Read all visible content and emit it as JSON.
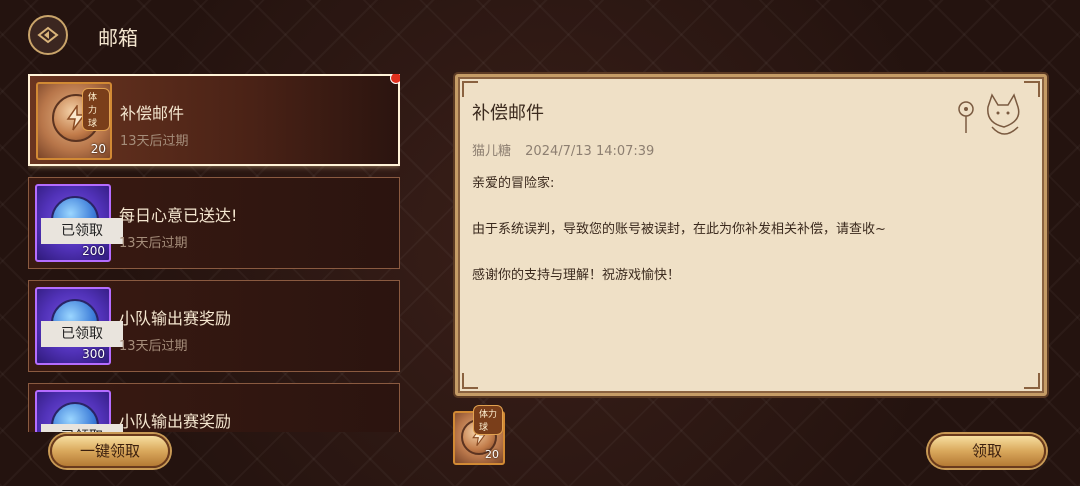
{
  "header": {
    "title": "邮箱"
  },
  "mails": [
    {
      "name": "补偿邮件",
      "expire": "13天后过期",
      "qty": "20",
      "tag": "体力球",
      "selected": true,
      "claimed": false,
      "unread": true
    },
    {
      "name": "每日心意已送达!",
      "expire": "13天后过期",
      "qty": "200",
      "claimed": true,
      "claimed_label": "已领取"
    },
    {
      "name": "小队输出赛奖励",
      "expire": "13天后过期",
      "qty": "300",
      "claimed": true,
      "claimed_label": "已领取"
    },
    {
      "name": "小队输出赛奖励",
      "claimed": true,
      "claimed_label": "已领取"
    }
  ],
  "detail": {
    "title": "补偿邮件",
    "sender": "猫儿糖",
    "datetime": "2024/7/13 14:07:39",
    "greeting": "亲爱的冒险家:",
    "body": "由于系统误判，导致您的账号被误封，在此为你补发相关补偿，请查收~",
    "closing": "感谢你的支持与理解！祝游戏愉快！"
  },
  "attachment": {
    "tag": "体力球",
    "qty": "20"
  },
  "buttons": {
    "claim_all": "一键领取",
    "claim": "领取"
  },
  "colors": {
    "accent_gold": "#d9a85c",
    "panel_bg": "#efe0c6",
    "selected_border": "#fff3d8",
    "unread_dot": "#e0301e"
  }
}
